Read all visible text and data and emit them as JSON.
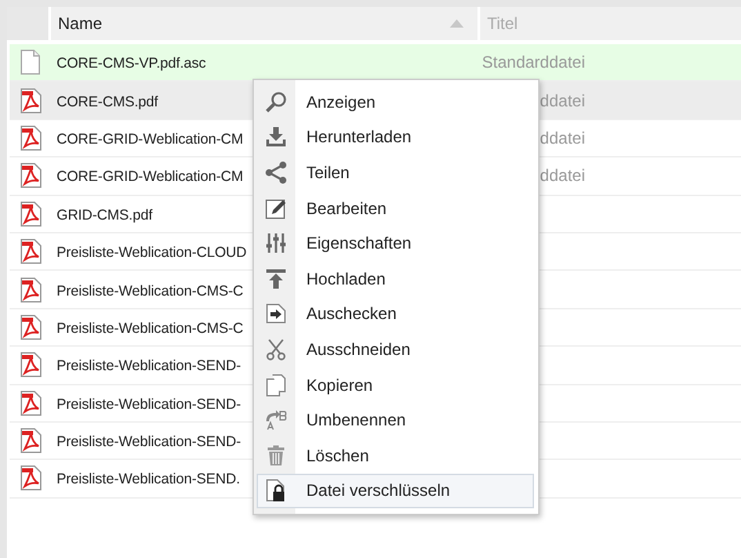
{
  "table": {
    "columns": [
      {
        "label": "Name",
        "sorted": true
      },
      {
        "label": "Titel",
        "sorted": false
      }
    ],
    "rows": [
      {
        "kind": "file",
        "name": "CORE-CMS-VP.pdf.asc",
        "title": "Standarddatei",
        "selected": true,
        "hovered": false
      },
      {
        "kind": "pdf",
        "name": "CORE-CMS.pdf",
        "title": "ddatei",
        "selected": false,
        "hovered": true
      },
      {
        "kind": "pdf",
        "name": "CORE-GRID-Weblication-CM",
        "title": "ddatei",
        "selected": false,
        "hovered": false
      },
      {
        "kind": "pdf",
        "name": "CORE-GRID-Weblication-CM",
        "title": "ddatei",
        "selected": false,
        "hovered": false
      },
      {
        "kind": "pdf",
        "name": "GRID-CMS.pdf",
        "selected": false,
        "hovered": false
      },
      {
        "kind": "pdf",
        "name": "Preisliste-Weblication-CLOUD",
        "selected": false,
        "hovered": false
      },
      {
        "kind": "pdf",
        "name": "Preisliste-Weblication-CMS-C",
        "selected": false,
        "hovered": false
      },
      {
        "kind": "pdf",
        "name": "Preisliste-Weblication-CMS-C",
        "selected": false,
        "hovered": false
      },
      {
        "kind": "pdf",
        "name": "Preisliste-Weblication-SEND-",
        "selected": false,
        "hovered": false
      },
      {
        "kind": "pdf",
        "name": "Preisliste-Weblication-SEND-",
        "selected": false,
        "hovered": false
      },
      {
        "kind": "pdf",
        "name": "Preisliste-Weblication-SEND-",
        "selected": false,
        "hovered": false
      },
      {
        "kind": "pdf",
        "name": "Preisliste-Weblication-SEND.",
        "selected": false,
        "hovered": false
      }
    ]
  },
  "context_menu": {
    "items": [
      {
        "kind": "view",
        "label": "Anzeigen",
        "highlighted": false
      },
      {
        "kind": "download",
        "label": "Herunterladen",
        "highlighted": false
      },
      {
        "kind": "share",
        "label": "Teilen",
        "highlighted": false
      },
      {
        "kind": "edit",
        "label": "Bearbeiten",
        "highlighted": false
      },
      {
        "kind": "properties",
        "label": "Eigenschaften",
        "highlighted": false
      },
      {
        "kind": "upload",
        "label": "Hochladen",
        "highlighted": false
      },
      {
        "kind": "checkout",
        "label": "Auschecken",
        "highlighted": false
      },
      {
        "kind": "cut",
        "label": "Ausschneiden",
        "highlighted": false
      },
      {
        "kind": "copy",
        "label": "Kopieren",
        "highlighted": false
      },
      {
        "kind": "rename",
        "label": "Umbenennen",
        "highlighted": false
      },
      {
        "kind": "delete",
        "label": "Löschen",
        "highlighted": false
      },
      {
        "kind": "encrypt",
        "label": "Datei verschlüsseln",
        "highlighted": true
      }
    ]
  }
}
